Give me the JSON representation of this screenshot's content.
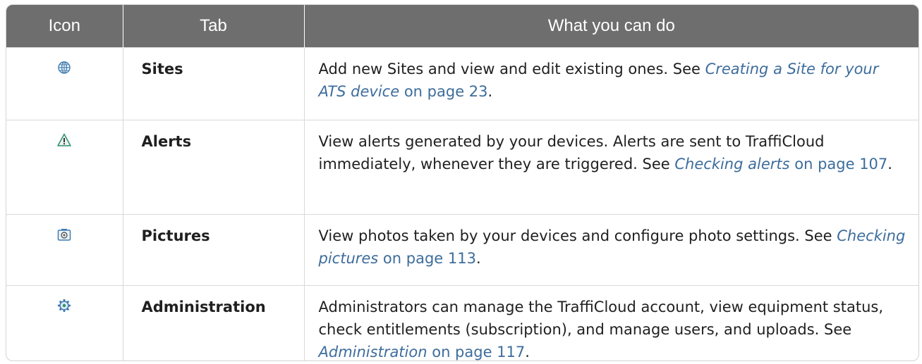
{
  "header": {
    "col_icon": "Icon",
    "col_tab": "Tab",
    "col_desc": "What you can do"
  },
  "rows": [
    {
      "icon": "globe-icon",
      "tab": "Sites",
      "desc_pre": "Add new Sites and view and edit existing ones. See ",
      "link_title": "Creating a Site for your ATS device",
      "link_page": " on page 23",
      "desc_post": "."
    },
    {
      "icon": "warning-icon",
      "tab": "Alerts",
      "desc_pre": "View alerts generated by your devices. Alerts are sent to TraffiCloud immediately, whenever they are triggered. See ",
      "link_title": "Checking alerts",
      "link_page": " on page 107",
      "desc_post": "."
    },
    {
      "icon": "camera-icon",
      "tab": "Pictures",
      "desc_pre": "View photos taken by your devices and configure photo settings. See ",
      "link_title": "Checking pictures",
      "link_page": " on page 113",
      "desc_post": "."
    },
    {
      "icon": "gear-icon",
      "tab": "Administration",
      "desc_pre": "Administrators can manage the TraffiCloud account, view equipment status, check entitlements (subscription), and manage users, and uploads. See ",
      "link_title": "Administration",
      "link_page": " on page 117",
      "desc_post": "."
    }
  ],
  "colors": {
    "header_bg": "#6e6e6e",
    "link": "#3d6d9c",
    "icon_blue": "#3e7bb0",
    "icon_green": "#2f8f6f"
  }
}
